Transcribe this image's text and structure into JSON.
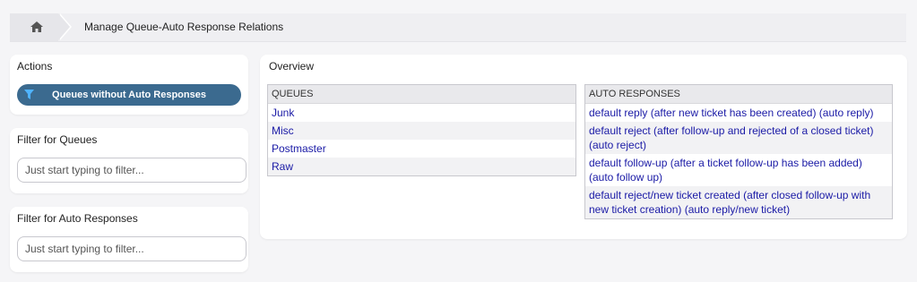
{
  "breadcrumb": {
    "home_icon": "home-icon",
    "title": "Manage Queue-Auto Response Relations"
  },
  "sidebar": {
    "actions": {
      "heading": "Actions",
      "button_label": "Queues without Auto Responses",
      "button_icon": "filter-icon"
    },
    "filter_queues": {
      "heading": "Filter for Queues",
      "placeholder": "Just start typing to filter..."
    },
    "filter_responses": {
      "heading": "Filter for Auto Responses",
      "placeholder": "Just start typing to filter..."
    }
  },
  "overview": {
    "heading": "Overview",
    "queues": {
      "header": "QUEUES",
      "items": [
        "Junk",
        "Misc",
        "Postmaster",
        "Raw"
      ]
    },
    "auto_responses": {
      "header": "AUTO RESPONSES",
      "items": [
        "default reply (after new ticket has been created) (auto reply)",
        "default reject (after follow-up and rejected of a closed ticket) (auto reject)",
        "default follow-up (after a ticket follow-up has been added) (auto follow up)",
        "default reject/new ticket created (after closed follow-up with new ticket creation) (auto reply/new ticket)"
      ]
    }
  },
  "colors": {
    "accent": "#3b6a8f",
    "link": "#1a1aa6",
    "page_bg": "#f5f5f7"
  }
}
